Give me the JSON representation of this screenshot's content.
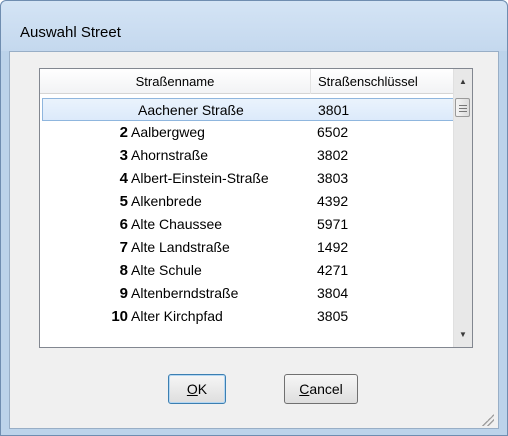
{
  "window": {
    "title": "Auswahl Street"
  },
  "list": {
    "columns": {
      "name": "Straßenname",
      "key": "Straßenschlüssel"
    },
    "rows": [
      {
        "num": "",
        "name": "Aachener Straße",
        "key": "3801",
        "selected": true
      },
      {
        "num": "2",
        "name": "Aalbergweg",
        "key": "6502"
      },
      {
        "num": "3",
        "name": "Ahornstraße",
        "key": "3802"
      },
      {
        "num": "4",
        "name": "Albert-Einstein-Straße",
        "key": "3803"
      },
      {
        "num": "5",
        "name": "Alkenbrede",
        "key": "4392"
      },
      {
        "num": "6",
        "name": "Alte Chaussee",
        "key": "5971"
      },
      {
        "num": "7",
        "name": "Alte Landstraße",
        "key": "1492"
      },
      {
        "num": "8",
        "name": "Alte Schule",
        "key": "4271"
      },
      {
        "num": "9",
        "name": "Altenberndstraße",
        "key": "3804"
      },
      {
        "num": "10",
        "name": "Alter Kirchpfad",
        "key": "3805"
      }
    ]
  },
  "buttons": {
    "ok_mnemonic": "O",
    "ok_rest": "K",
    "cancel_mnemonic": "C",
    "cancel_rest": "ancel"
  },
  "icons": {
    "scroll_up": "scroll-up-arrow",
    "scroll_down": "scroll-down-arrow",
    "resize": "resize-grip"
  }
}
